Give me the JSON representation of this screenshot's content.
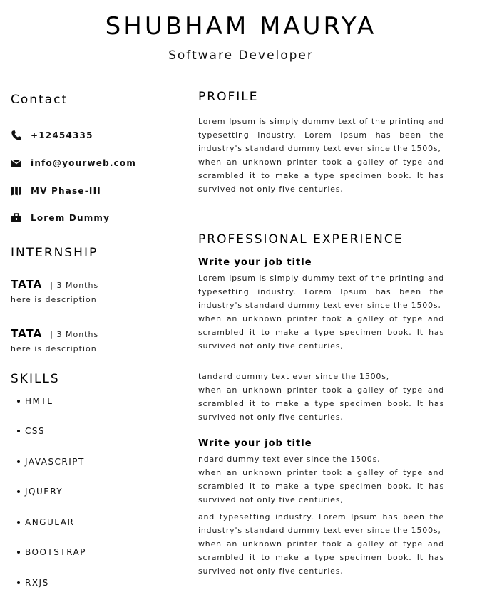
{
  "header": {
    "name": "SHUBHAM MAURYA",
    "role": "Software Developer"
  },
  "contact": {
    "heading": "Contact",
    "items": [
      {
        "icon": "phone-icon",
        "text": "+12454335"
      },
      {
        "icon": "mail-icon",
        "text": "info@yourweb.com"
      },
      {
        "icon": "map-icon",
        "text": "MV Phase-III"
      },
      {
        "icon": "briefcase-icon",
        "text": "Lorem Dummy"
      }
    ]
  },
  "internship": {
    "heading": "INTERNSHIP",
    "items": [
      {
        "company": "TATA",
        "duration": "| 3 Months",
        "desc": "here is description"
      },
      {
        "company": "TATA",
        "duration": "| 3 Months",
        "desc": "here is description"
      }
    ]
  },
  "skills": {
    "heading": "SKILLS",
    "items": [
      "HMTL",
      "CSS",
      "JAVASCRIPT",
      "JQUERY",
      "ANGULAR",
      "BOOTSTRAP",
      "RXJS"
    ]
  },
  "profile": {
    "heading": "PROFILE",
    "lines": [
      "Lorem Ipsum is simply dummy text of the printing and typesetting industry. Lorem Ipsum has been the industry's standard dummy text ever since the 1500s,",
      "when an unknown printer took a galley of type and scrambled it to make a type specimen book. It has survived not only five centuries,"
    ]
  },
  "experience": {
    "heading": "PROFESSIONAL EXPERIENCE",
    "jobs": [
      {
        "title": "Write your job title",
        "paras": [
          [
            "Lorem Ipsum is simply dummy text of the printing and typesetting industry. Lorem Ipsum has been the industry's standard dummy text ever since the 1500s,",
            "when an unknown printer took a galley of type and scrambled it to make a type specimen book. It has survived not only five centuries,"
          ],
          [
            "tandard dummy text ever since the 1500s,",
            "when an unknown printer took a galley of type and scrambled it to make a type specimen book. It has survived not only five centuries,"
          ]
        ]
      },
      {
        "title": "Write your job title",
        "paras": [
          [
            "ndard dummy text ever since the 1500s,",
            "when an unknown printer took a galley of type and scrambled it to make a type specimen book. It has survived not only five centuries,"
          ],
          [
            "and typesetting industry. Lorem Ipsum has been the industry's standard dummy text ever since the 1500s,",
            "when an unknown printer took a galley of type and scrambled it to make a type specimen book. It has survived not only five centuries,"
          ]
        ]
      }
    ]
  }
}
